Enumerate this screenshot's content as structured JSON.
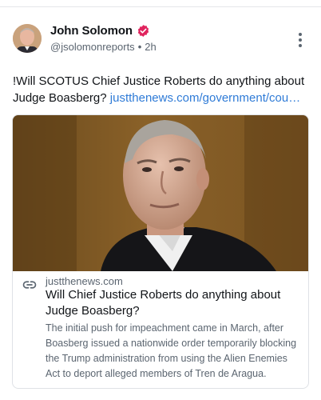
{
  "post": {
    "author_name": "John Solomon",
    "handle": "@jsolomonreports",
    "separator": "•",
    "timestamp": "2h",
    "text": "!Will SCOTUS Chief Justice Roberts do anything about Judge Boasberg?",
    "link_text": "justthenews.com/government/cou…"
  },
  "card": {
    "domain": "justthenews.com",
    "title": "Will Chief Justice Roberts do anything about Judge Boasberg?",
    "description": "The initial push for impeachment came in March, after Boasberg issued a nationwide order temporarily blocking the Trump administration from using the Alien Enemies Act to deport alleged members of Tren de Aragua."
  },
  "icons": {
    "verified": "verified-badge-icon",
    "more": "more-vertical-icon",
    "link": "link-icon"
  },
  "colors": {
    "verified_badge": "#e0245e",
    "link": "#2f7bd7",
    "muted_text": "#5b6570"
  }
}
